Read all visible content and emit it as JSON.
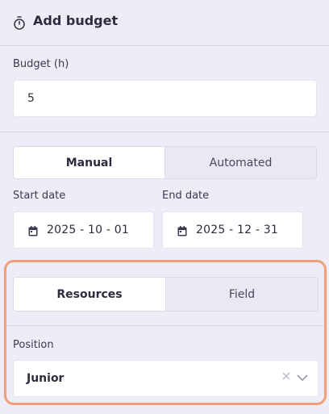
{
  "header": {
    "title": "Add budget",
    "icon": "timer-icon"
  },
  "budget": {
    "label": "Budget (h)",
    "value": "5"
  },
  "mode": {
    "options": [
      "Manual",
      "Automated"
    ],
    "selected": "Manual"
  },
  "start_date": {
    "label": "Start date",
    "value": "2025 - 10 - 01"
  },
  "end_date": {
    "label": "End date",
    "value": "2025 - 12 - 31"
  },
  "target": {
    "options": [
      "Resources",
      "Field"
    ],
    "selected": "Resources"
  },
  "position": {
    "label": "Position",
    "value": "Junior"
  },
  "colors": {
    "highlight": "#f29f77",
    "background": "#eeecf6"
  }
}
